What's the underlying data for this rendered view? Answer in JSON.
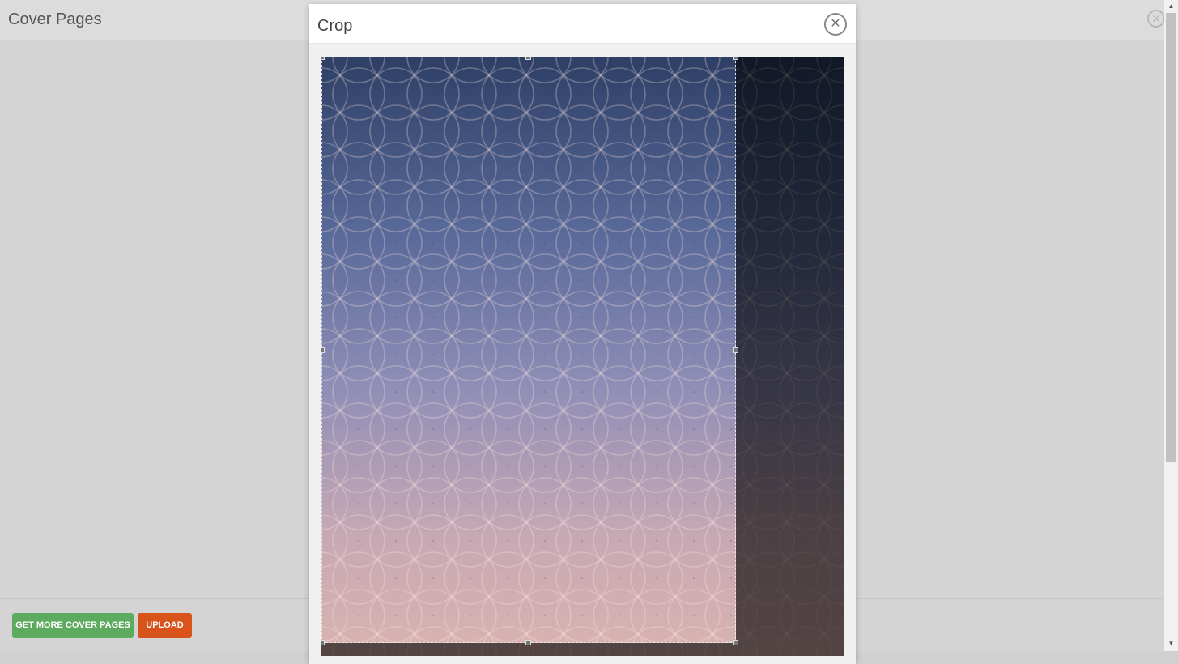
{
  "background": {
    "title": "Cover Pages",
    "close_icon": "close-icon",
    "buttons": {
      "get_more": "GET MORE COVER PAGES",
      "upload": "UPLOAD"
    },
    "colors": {
      "green": "#5cab5e",
      "orange": "#d9541b"
    }
  },
  "modal": {
    "title": "Crop",
    "close_icon": "close-icon",
    "image": {
      "pattern": "overlapping-circles",
      "colors": [
        "#2e3f66",
        "#8f8eb6",
        "#d9b3b0"
      ]
    }
  }
}
